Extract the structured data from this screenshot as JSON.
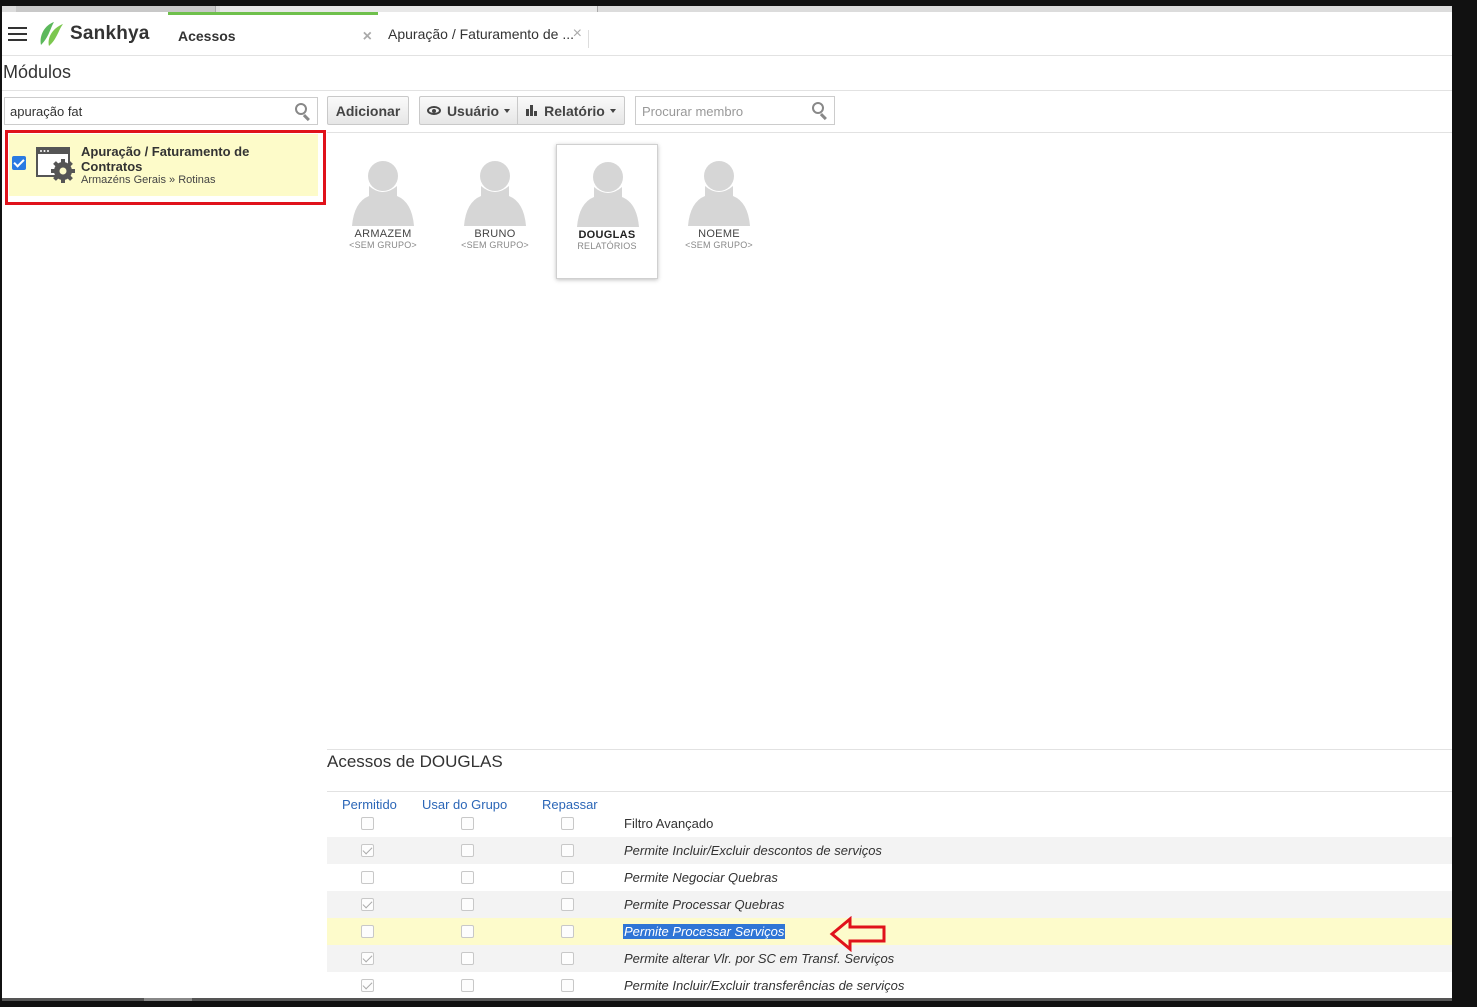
{
  "header": {
    "brand": "Sankhya",
    "tabs": [
      {
        "label": "Acessos",
        "active": true
      },
      {
        "label": "Apuração / Faturamento de ...",
        "active": false
      }
    ],
    "accent_color": "#6fc04c"
  },
  "modules": {
    "title": "Módulos",
    "search_value": "apuração fat",
    "items": [
      {
        "title": "Apuração / Faturamento de Contratos",
        "path": "Armazéns Gerais » Rotinas",
        "checked": true
      }
    ]
  },
  "toolbar": {
    "add_label": "Adicionar",
    "user_label": "Usuário",
    "report_label": "Relatório",
    "member_search_placeholder": "Procurar membro"
  },
  "members": [
    {
      "name": "ARMAZEM",
      "group": "<SEM GRUPO>",
      "selected": false
    },
    {
      "name": "BRUNO",
      "group": "<SEM GRUPO>",
      "selected": false
    },
    {
      "name": "DOUGLAS",
      "group": "RELATÓRIOS",
      "selected": true
    },
    {
      "name": "NOEME",
      "group": "<SEM GRUPO>",
      "selected": false
    }
  ],
  "access": {
    "title": "Acessos de DOUGLAS",
    "columns": [
      "Permitido",
      "Usar do Grupo",
      "Repassar"
    ],
    "rows": [
      {
        "label": "Filtro Avançado",
        "permitido": false,
        "usar_grupo": false,
        "repassar": false
      },
      {
        "label": "Permite Incluir/Excluir descontos de serviços",
        "permitido": true,
        "usar_grupo": false,
        "repassar": false
      },
      {
        "label": "Permite Negociar Quebras",
        "permitido": false,
        "usar_grupo": false,
        "repassar": false
      },
      {
        "label": "Permite Processar Quebras",
        "permitido": true,
        "usar_grupo": false,
        "repassar": false
      },
      {
        "label": "Permite Processar Serviços",
        "permitido": false,
        "usar_grupo": false,
        "repassar": false,
        "highlighted": true
      },
      {
        "label": "Permite alterar Vlr. por SC em Transf. Serviços",
        "permitido": true,
        "usar_grupo": false,
        "repassar": false
      },
      {
        "label": "Permite Incluir/Excluir transferências de serviços",
        "permitido": true,
        "usar_grupo": false,
        "repassar": false
      }
    ]
  },
  "annotation": {
    "highlight_color": "#e0121b"
  }
}
